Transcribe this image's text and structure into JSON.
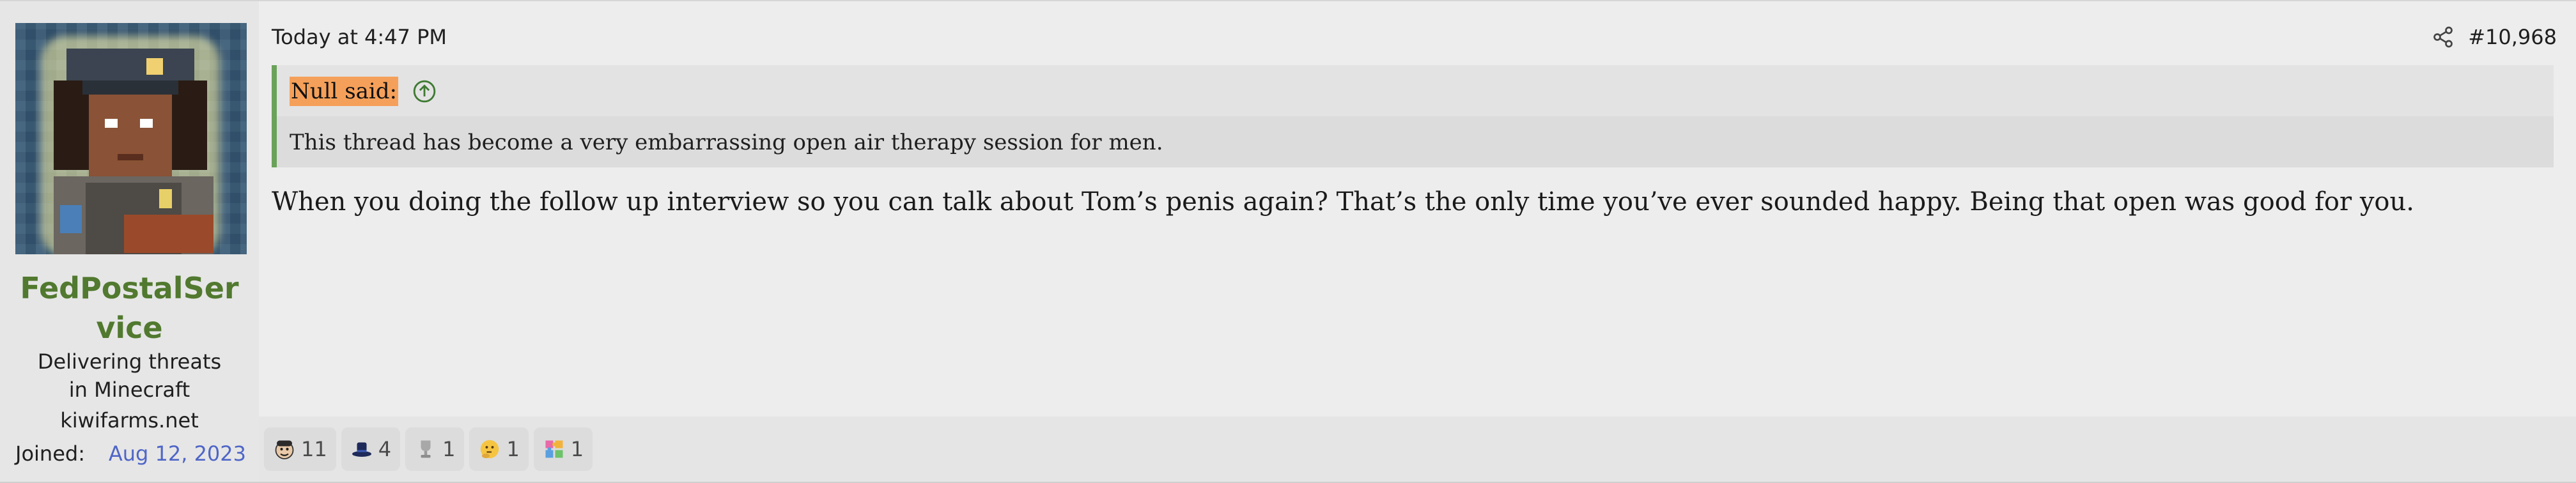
{
  "user": {
    "name": "FedPostalService",
    "title": "Delivering threats in Minecraft",
    "banner": "kiwifarms.net",
    "joined_label": "Joined:",
    "joined_value": "Aug 12, 2023"
  },
  "post": {
    "date": "Today at 4:47 PM",
    "number": "#10,968",
    "share_icon": "share-icon",
    "quote": {
      "author": "Null said:",
      "jump_icon": "arrow-up-circle-icon",
      "text": "This thread has become a very embarrassing open air therapy session for men."
    },
    "message": "When you doing the follow up interview so you can talk about Tom’s penis again? That’s the only time you’ve ever sounded happy. Being that open was good for you."
  },
  "reactions": [
    {
      "icon": "face-emoji-icon",
      "count": "11"
    },
    {
      "icon": "top-hat-icon",
      "count": "4"
    },
    {
      "icon": "trophy-icon",
      "count": "1"
    },
    {
      "icon": "thinking-face-icon",
      "count": "1"
    },
    {
      "icon": "puzzle-icon",
      "count": "1"
    }
  ],
  "colors": {
    "username": "#51792f",
    "joined_date": "#4f66c7",
    "quote_border": "#6aa25a",
    "author_highlight": "#f5a05a"
  }
}
